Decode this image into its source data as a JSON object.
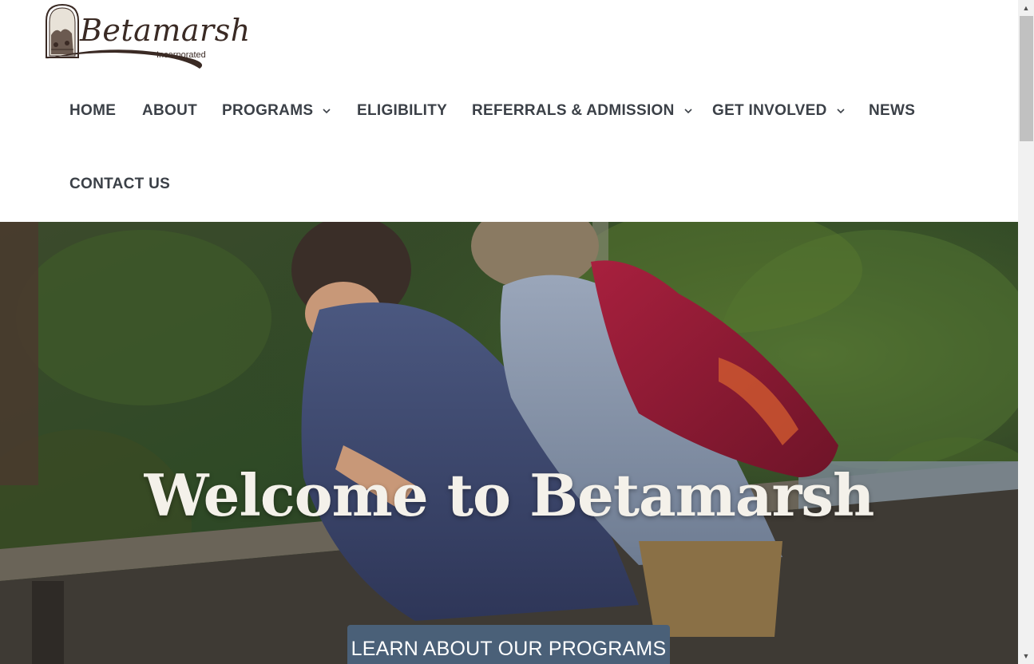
{
  "logo": {
    "name": "Betamarsh",
    "subtitle": "Incorporated"
  },
  "nav": {
    "items": [
      {
        "label": "HOME",
        "has_dropdown": false
      },
      {
        "label": "ABOUT",
        "has_dropdown": false
      },
      {
        "label": "PROGRAMS",
        "has_dropdown": true
      },
      {
        "label": "ELIGIBILITY",
        "has_dropdown": false
      },
      {
        "label": "REFERRALS & ADMISSION",
        "has_dropdown": true
      },
      {
        "label": "GET INVOLVED",
        "has_dropdown": true
      },
      {
        "label": "NEWS",
        "has_dropdown": false
      },
      {
        "label": "CONTACT US",
        "has_dropdown": false
      }
    ]
  },
  "hero": {
    "title": "Welcome to Betamarsh",
    "cta_label": "LEARN ABOUT OUR PROGRAMS"
  },
  "colors": {
    "nav_text": "#3b4047",
    "cta_background": "#4a6078",
    "hero_title": "#f4f1ea"
  },
  "icons": {
    "dropdown": "chevron-down-icon",
    "scroll_up": "arrow-up-icon",
    "scroll_down": "arrow-down-icon"
  }
}
